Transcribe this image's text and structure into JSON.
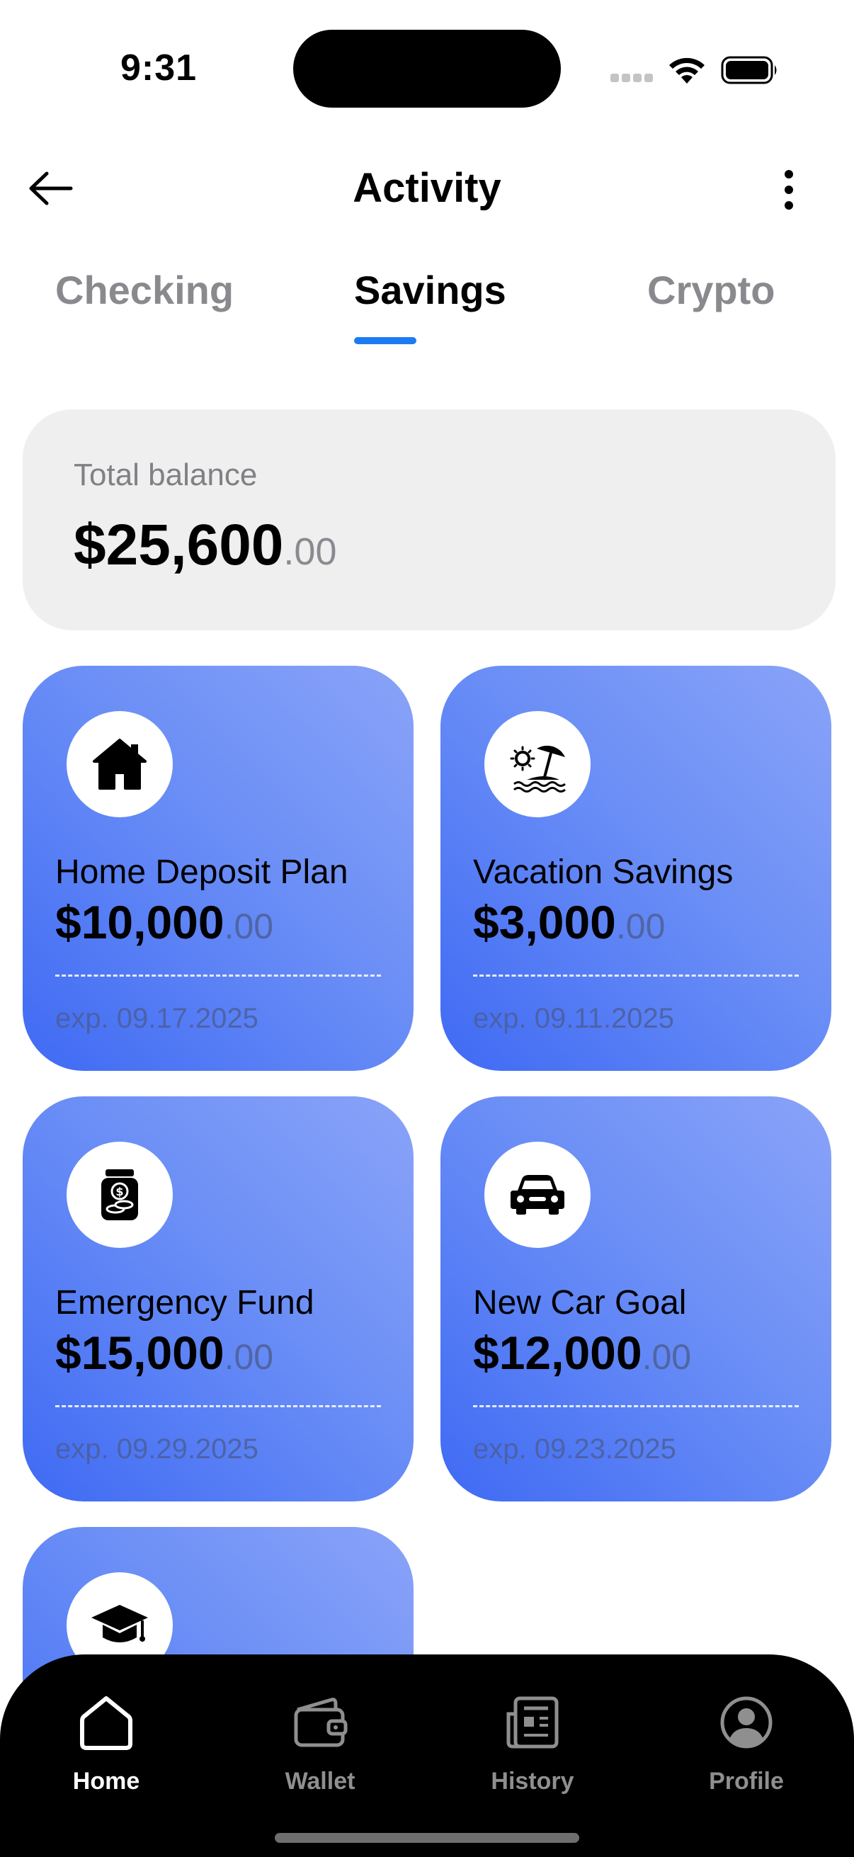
{
  "status_bar": {
    "time": "9:31"
  },
  "header": {
    "title": "Activity",
    "back_icon": "arrow-left-icon",
    "more_icon": "more-vertical-icon"
  },
  "tabs": [
    {
      "label": "Checking",
      "active": false
    },
    {
      "label": "Savings",
      "active": true
    },
    {
      "label": "Crypto",
      "active": false
    }
  ],
  "balance": {
    "label": "Total balance",
    "amount": "$25,600",
    "cents": ".00"
  },
  "savings_cards": [
    {
      "icon": "house-icon",
      "title": "Home Deposit Plan",
      "amount": "$10,000",
      "cents": ".00",
      "exp": "exp. 09.17.2025"
    },
    {
      "icon": "beach-umbrella-icon",
      "title": "Vacation Savings",
      "amount": "$3,000",
      "cents": ".00",
      "exp": "exp. 09.11.2025"
    },
    {
      "icon": "savings-jar-icon",
      "title": "Emergency Fund",
      "amount": "$15,000",
      "cents": ".00",
      "exp": "exp. 09.29.2025"
    },
    {
      "icon": "car-icon",
      "title": "New Car Goal",
      "amount": "$12,000",
      "cents": ".00",
      "exp": "exp. 09.23.2025"
    },
    {
      "icon": "graduation-cap-icon"
    }
  ],
  "bottom_nav": [
    {
      "label": "Home",
      "icon": "home-icon",
      "active": true
    },
    {
      "label": "Wallet",
      "icon": "wallet-icon",
      "active": false
    },
    {
      "label": "History",
      "icon": "newspaper-icon",
      "active": false
    },
    {
      "label": "Profile",
      "icon": "profile-icon",
      "active": false
    }
  ],
  "colors": {
    "accent": "#1d7bf2",
    "card_gradient_start": "#8aa3f8",
    "card_gradient_end": "#3f6af4",
    "nav_background": "#000000"
  }
}
